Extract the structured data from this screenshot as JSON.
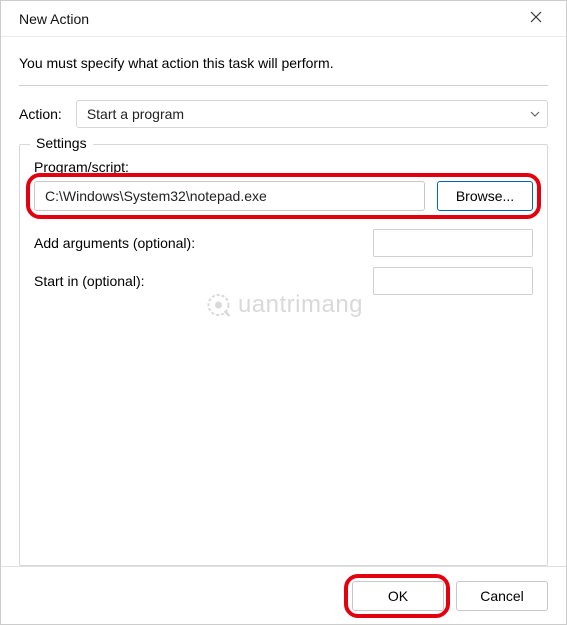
{
  "window": {
    "title": "New Action"
  },
  "instruction": "You must specify what action this task will perform.",
  "action": {
    "label": "Action:",
    "selected": "Start a program"
  },
  "settings": {
    "legend": "Settings",
    "program_label": "Program/script:",
    "program_value": "C:\\Windows\\System32\\notepad.exe",
    "browse_label": "Browse...",
    "args_label": "Add arguments (optional):",
    "args_value": "",
    "startin_label": "Start in (optional):",
    "startin_value": ""
  },
  "footer": {
    "ok": "OK",
    "cancel": "Cancel"
  },
  "watermark": "uantrimang"
}
